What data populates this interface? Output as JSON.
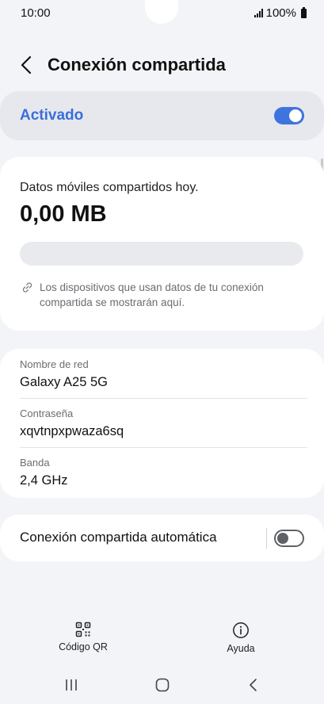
{
  "status_bar": {
    "time": "10:00",
    "battery": "100%"
  },
  "header": {
    "title": "Conexión compartida"
  },
  "master_toggle": {
    "label": "Activado",
    "on": true
  },
  "usage": {
    "label": "Datos móviles compartidos hoy.",
    "value": "0,00 MB",
    "hint": "Los dispositivos que usan datos de tu conexión compartida se mostrarán aquí."
  },
  "network": {
    "name_label": "Nombre de red",
    "name_value": "Galaxy A25 5G",
    "password_label": "Contraseña",
    "password_value": "xqvtnpxpwaza6sq",
    "band_label": "Banda",
    "band_value": "2,4 GHz"
  },
  "auto_hotspot": {
    "label": "Conexión compartida automática",
    "on": false
  },
  "bottom_actions": {
    "qr_label": "Código QR",
    "help_label": "Ayuda"
  },
  "colors": {
    "accent": "#3e74dd",
    "page_bg": "#f3f4f7",
    "card_bg": "#ffffff",
    "active_card_bg": "#e6e8ee"
  },
  "icons": [
    "back-arrow-icon",
    "link-icon",
    "qr-code-icon",
    "info-icon",
    "recents-icon",
    "home-icon",
    "nav-back-icon"
  ]
}
